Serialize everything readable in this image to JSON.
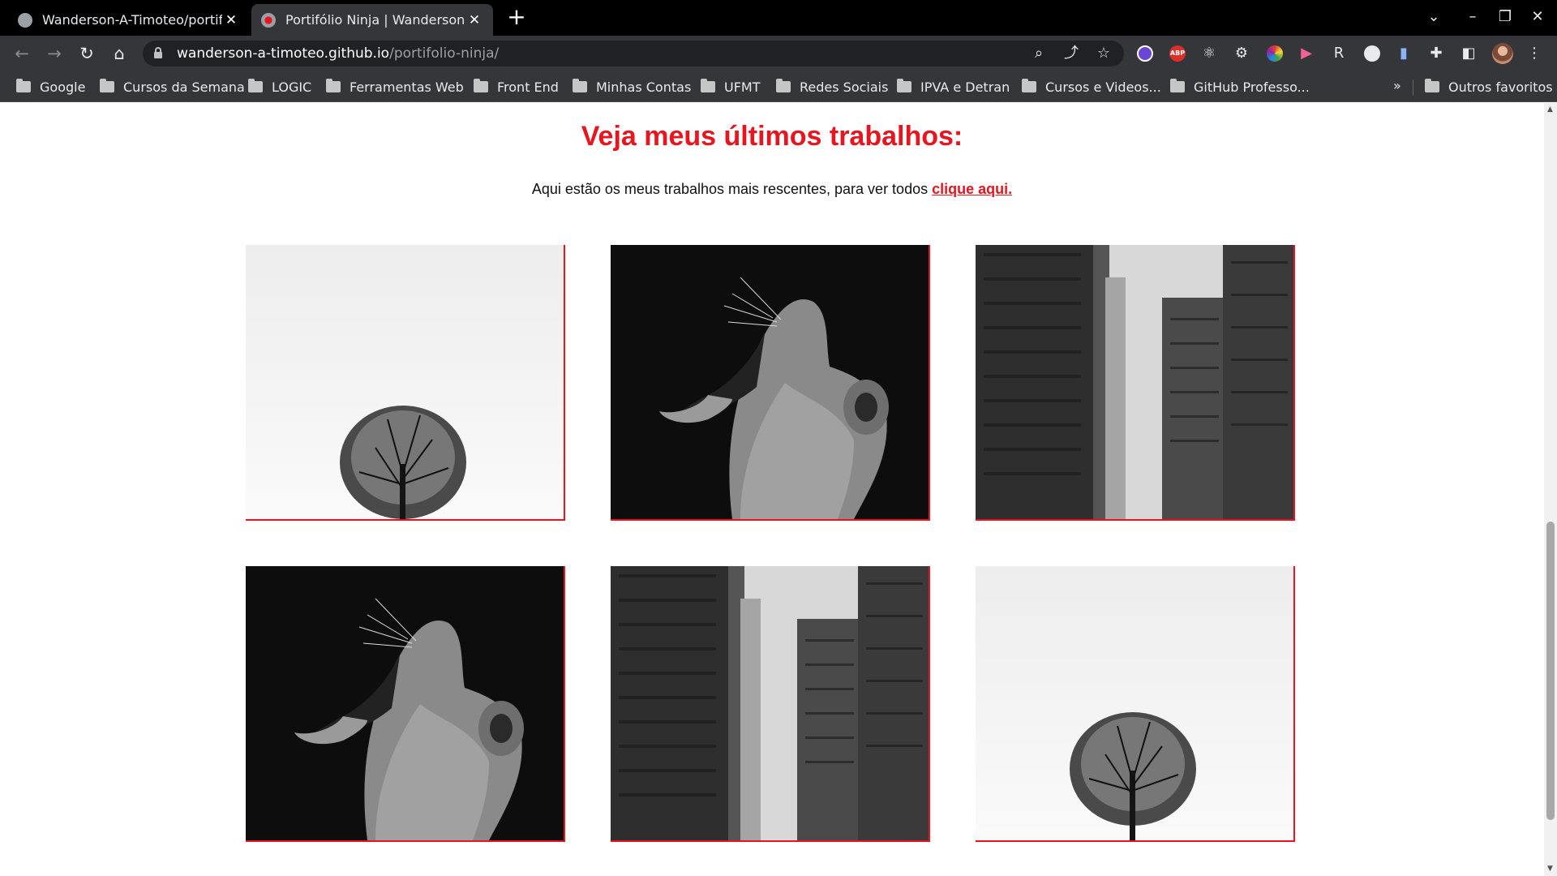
{
  "browser": {
    "tabs": [
      {
        "title": "Wanderson-A-Timoteo/portifo",
        "favicon": "github-icon",
        "active": false
      },
      {
        "title": "Portifólio Ninja | Wanderson T",
        "favicon": "ninja-icon",
        "active": true
      }
    ],
    "url_host": "wanderson-a-timoteo.github.io",
    "url_path": "/portifolio-ninja/",
    "bookmarks": [
      "Google",
      "Cursos da Semana",
      "LOGIC",
      "Ferramentas Web",
      "Front End",
      "Minhas Contas",
      "UFMT",
      "Redes Sociais",
      "IPVA e Detran",
      "Cursos e Videos...",
      "GitHub Professo..."
    ],
    "bookmarks_more": "»",
    "other_bookmarks": "Outros favoritos",
    "extension_abp": "ABP"
  },
  "page": {
    "heading": "Veja meus últimos trabalhos:",
    "subtitle_text": "Aqui estão os meus trabalhos mais rescentes, para ver todos ",
    "subtitle_link": "clique aqui.",
    "accent_color": "#e8141e",
    "works": [
      {
        "image": "tree-photo"
      },
      {
        "image": "lioness-photo"
      },
      {
        "image": "city-buildings-photo"
      },
      {
        "image": "lioness-photo"
      },
      {
        "image": "city-buildings-photo"
      },
      {
        "image": "tree-photo"
      }
    ]
  }
}
